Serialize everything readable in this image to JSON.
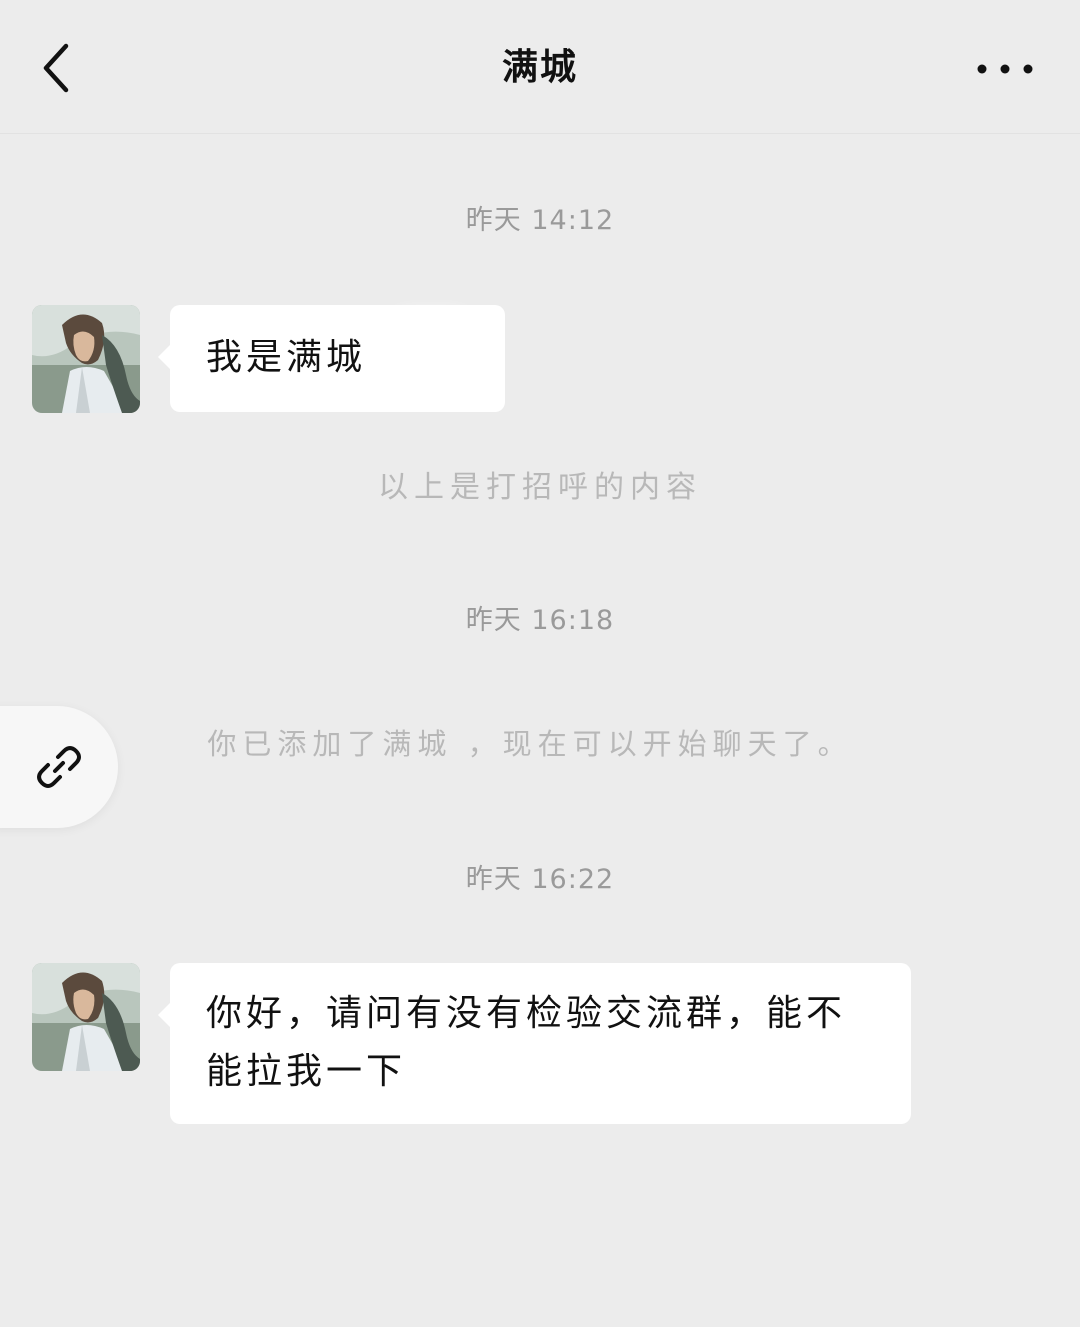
{
  "header": {
    "title": "满城",
    "back_icon": "chevron-left-icon",
    "more_icon": "more-dots-icon"
  },
  "messages": {
    "time1": "昨天 14:12",
    "greeting_text": "我是满城",
    "greeting_note": "以上是打招呼的内容",
    "time2": "昨天 16:18",
    "added_note": "你已添加了满城 ，现在可以开始聊天了。",
    "time3": "昨天 16:22",
    "message_text": "你好，请问有没有检验交流群，能不能拉我一下"
  },
  "floating_link": {
    "icon": "link-icon"
  }
}
